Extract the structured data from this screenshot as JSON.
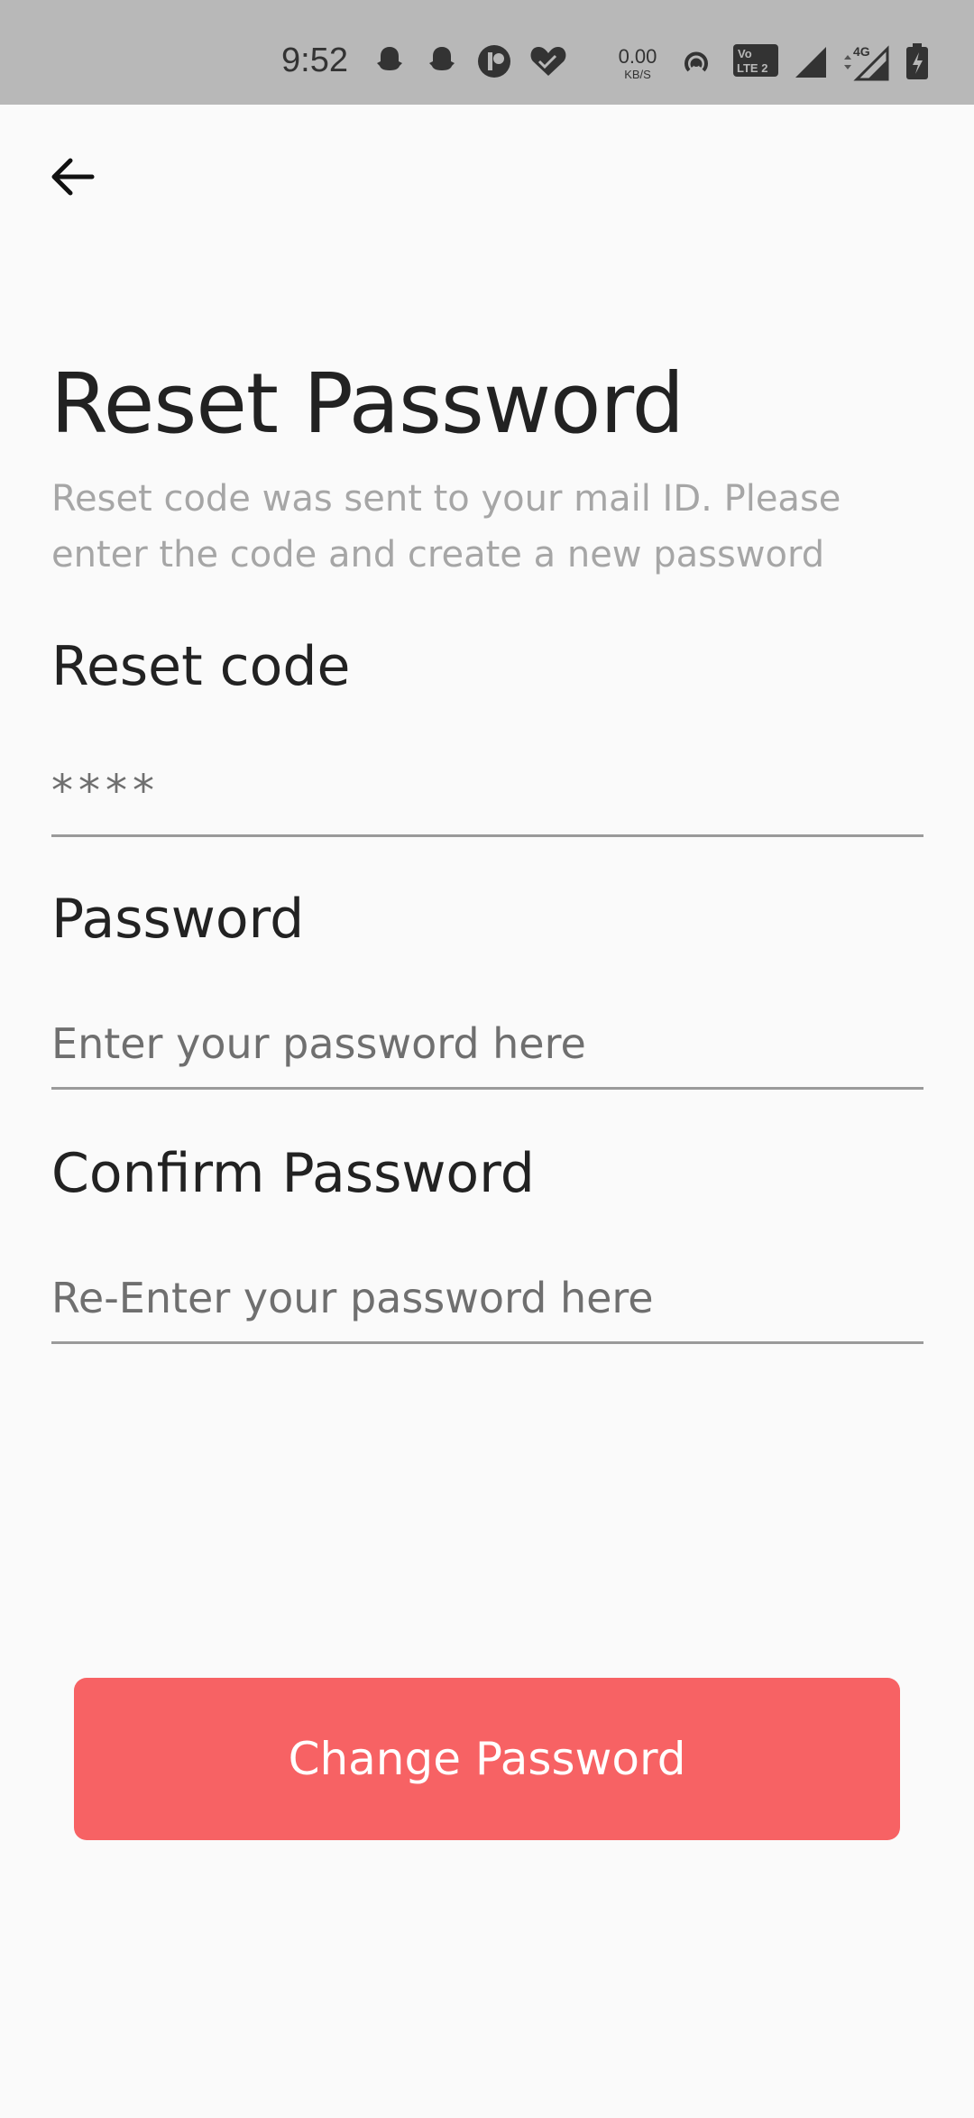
{
  "status_bar": {
    "time": "9:52",
    "network_speed": "0.00",
    "network_unit": "KB/S",
    "network_type": "4G",
    "volte_label_top": "Vo",
    "volte_label_bottom": "LTE 2",
    "icons": [
      "snapchat-icon",
      "snapchat-icon",
      "app-icon",
      "heart-icon",
      "hotspot-icon",
      "volte-icon",
      "signal-icon",
      "signal-4g-icon",
      "battery-charging-icon"
    ]
  },
  "back_button": {
    "icon": "arrow-left-icon"
  },
  "header": {
    "title": "Reset Password",
    "subtitle": "Reset code was sent to your mail ID. Please enter the code and create a new password"
  },
  "form": {
    "reset_code": {
      "label": "Reset code",
      "placeholder": "****"
    },
    "password": {
      "label": "Password",
      "placeholder": "Enter your password here"
    },
    "confirm_password": {
      "label": "Confirm Password",
      "placeholder": "Re-Enter your password here"
    }
  },
  "submit": {
    "label": "Change Password"
  },
  "colors": {
    "accent": "#f76264",
    "status_bar_bg": "#b8b8b8",
    "background": "#fafafa"
  }
}
